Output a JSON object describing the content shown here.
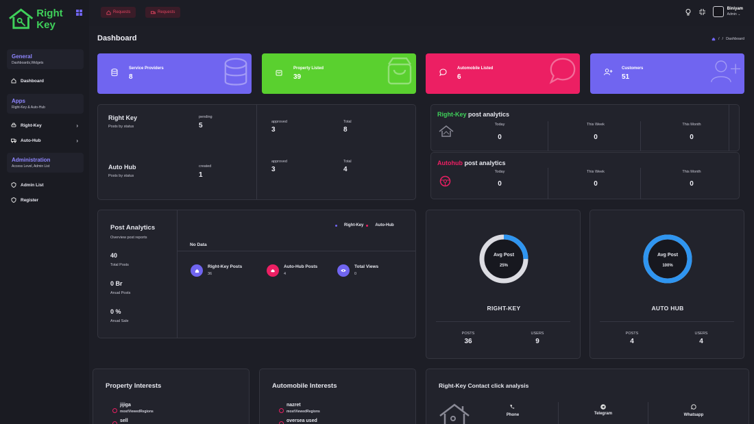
{
  "brand": {
    "name": "Right Key",
    "color": "#3fd05a"
  },
  "sidebar": {
    "sections": [
      {
        "title": "General",
        "subtitle": "Dashboards,Widgets"
      },
      {
        "title": "Apps",
        "subtitle": "Right-Key & Auto-Hub"
      },
      {
        "title": "Administration",
        "subtitle": "Access Level, Admin List"
      }
    ],
    "items": [
      {
        "label": "Dashboard",
        "icon": "home-icon"
      },
      {
        "label": "Right-Key",
        "icon": "car-icon"
      },
      {
        "label": "Auto-Hub",
        "icon": "truck-icon"
      },
      {
        "label": "Admin List",
        "icon": "shield-icon"
      },
      {
        "label": "Register",
        "icon": "shield-icon"
      }
    ]
  },
  "header": {
    "buttons": [
      {
        "label": "Requests"
      },
      {
        "label": "Requests"
      }
    ],
    "user": {
      "name": "Biniyam",
      "role": "Admin ⌄"
    }
  },
  "page": {
    "title": "Dashboard",
    "breadcrumb": "Dashboard"
  },
  "stats": [
    {
      "label": "Service Providers",
      "value": "8",
      "color": "#7065f0",
      "icon": "database-icon"
    },
    {
      "label": "Property Listed",
      "value": "39",
      "color": "#5ad02f",
      "icon": "bag-icon"
    },
    {
      "label": "Automobile Listed",
      "value": "6",
      "color": "#ec1f63",
      "icon": "chat-icon"
    },
    {
      "label": "Customers",
      "value": "51",
      "color": "#7065f0",
      "icon": "user-plus-icon"
    }
  ],
  "status": {
    "rightkey": {
      "title": "Right Key",
      "subtitle": "Posts by status",
      "pending_label": "pending",
      "pending": "5",
      "approved_label": "approved",
      "approved": "3",
      "total_label": "Total",
      "total": "8"
    },
    "autohub": {
      "title": "Auto Hub",
      "subtitle": "Posts by status",
      "created_label": "created",
      "created": "1",
      "approved_label": "approved",
      "approved": "3",
      "total_label": "Total",
      "total": "4"
    }
  },
  "post_analytics": {
    "rightkey": {
      "brand": "Right-Key",
      "title": " post analytics",
      "today_label": "Today",
      "today": "0",
      "week_label": "This Week",
      "week": "0",
      "month_label": "This Month",
      "month": "0"
    },
    "autohub": {
      "brand": "Autohub",
      "title": " post analytics",
      "today_label": "Today",
      "today": "0",
      "week_label": "This Week",
      "week": "0",
      "month_label": "This Month",
      "month": "0"
    }
  },
  "overview": {
    "title": "Post Analytics",
    "subtitle": "Overview post reports",
    "total_posts": "40",
    "total_posts_label": "Total Posts",
    "anual_posts": "0 Br",
    "anual_posts_label": "Anual Posts",
    "anual_sale": "0 %",
    "anual_sale_label": "Anual Sale",
    "legend": [
      {
        "name": "Right-Key",
        "color": "#7065f0"
      },
      {
        "name": "Auto-Hub",
        "color": "#ec1f63"
      }
    ],
    "no_data": "No Data",
    "metrics": [
      {
        "label": "Right-Key Posts",
        "value": "36",
        "color": "#7065f0",
        "icon": "home-icon"
      },
      {
        "label": "Auto-Hub Posts",
        "value": "4",
        "color": "#ec1f63",
        "icon": "car-icon"
      },
      {
        "label": "Total Views",
        "value": "0",
        "color": "#7065f0",
        "icon": "eye-icon"
      }
    ]
  },
  "donuts": [
    {
      "center_label": "Avg Post",
      "percent_label": "25%",
      "fraction": 0.25,
      "name": "RIGHT-KEY",
      "posts_label": "POSTS",
      "posts": "36",
      "users_label": "USERS",
      "users": "9"
    },
    {
      "center_label": "Avg Post",
      "percent_label": "100%",
      "fraction": 1.0,
      "name": "AUTO HUB",
      "posts_label": "POSTS",
      "posts": "4",
      "users_label": "USERS",
      "users": "4"
    }
  ],
  "property_interests": {
    "title": "Property Interests",
    "items": [
      {
        "name": "jijiga",
        "sub": "mostViewedRegions"
      },
      {
        "name": "sell",
        "sub": ""
      }
    ]
  },
  "automobile_interests": {
    "title": "Automobile Interests",
    "items": [
      {
        "name": "nazret",
        "sub": "mostViewedRegions"
      },
      {
        "name": "oversea used",
        "sub": ""
      }
    ]
  },
  "contact_analysis": {
    "title": "Right-Key Contact click analysis",
    "channels": [
      {
        "label": "Phone"
      },
      {
        "label": "Telegram"
      },
      {
        "label": "Whatsapp"
      }
    ]
  }
}
